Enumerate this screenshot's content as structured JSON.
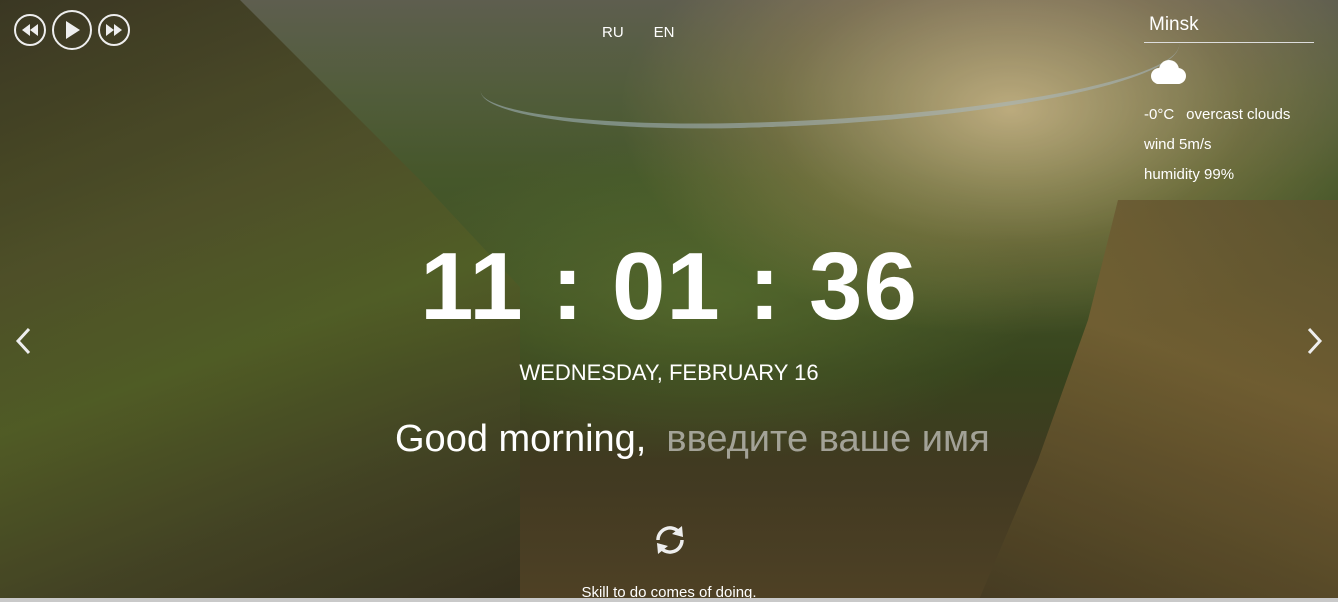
{
  "player": {
    "prev_icon": "rewind-icon",
    "play_icon": "play-icon",
    "next_icon": "fast-forward-icon"
  },
  "language": {
    "options": [
      "RU",
      "EN"
    ]
  },
  "weather": {
    "city_value": "Minsk",
    "icon": "cloud-icon",
    "temperature": "-0°C",
    "description": "overcast clouds",
    "wind": "wind 5m/s",
    "humidity": "humidity 99%"
  },
  "clock": {
    "time": "11 : 01 : 36",
    "date": "WEDNESDAY, FEBRUARY 16"
  },
  "greeting": {
    "text": "Good morning,",
    "name_placeholder": "введите ваше имя"
  },
  "slider": {
    "prev_icon": "chevron-left-icon",
    "next_icon": "chevron-right-icon"
  },
  "quote": {
    "refresh_icon": "refresh-icon",
    "text": "Skill to do comes of doing."
  }
}
